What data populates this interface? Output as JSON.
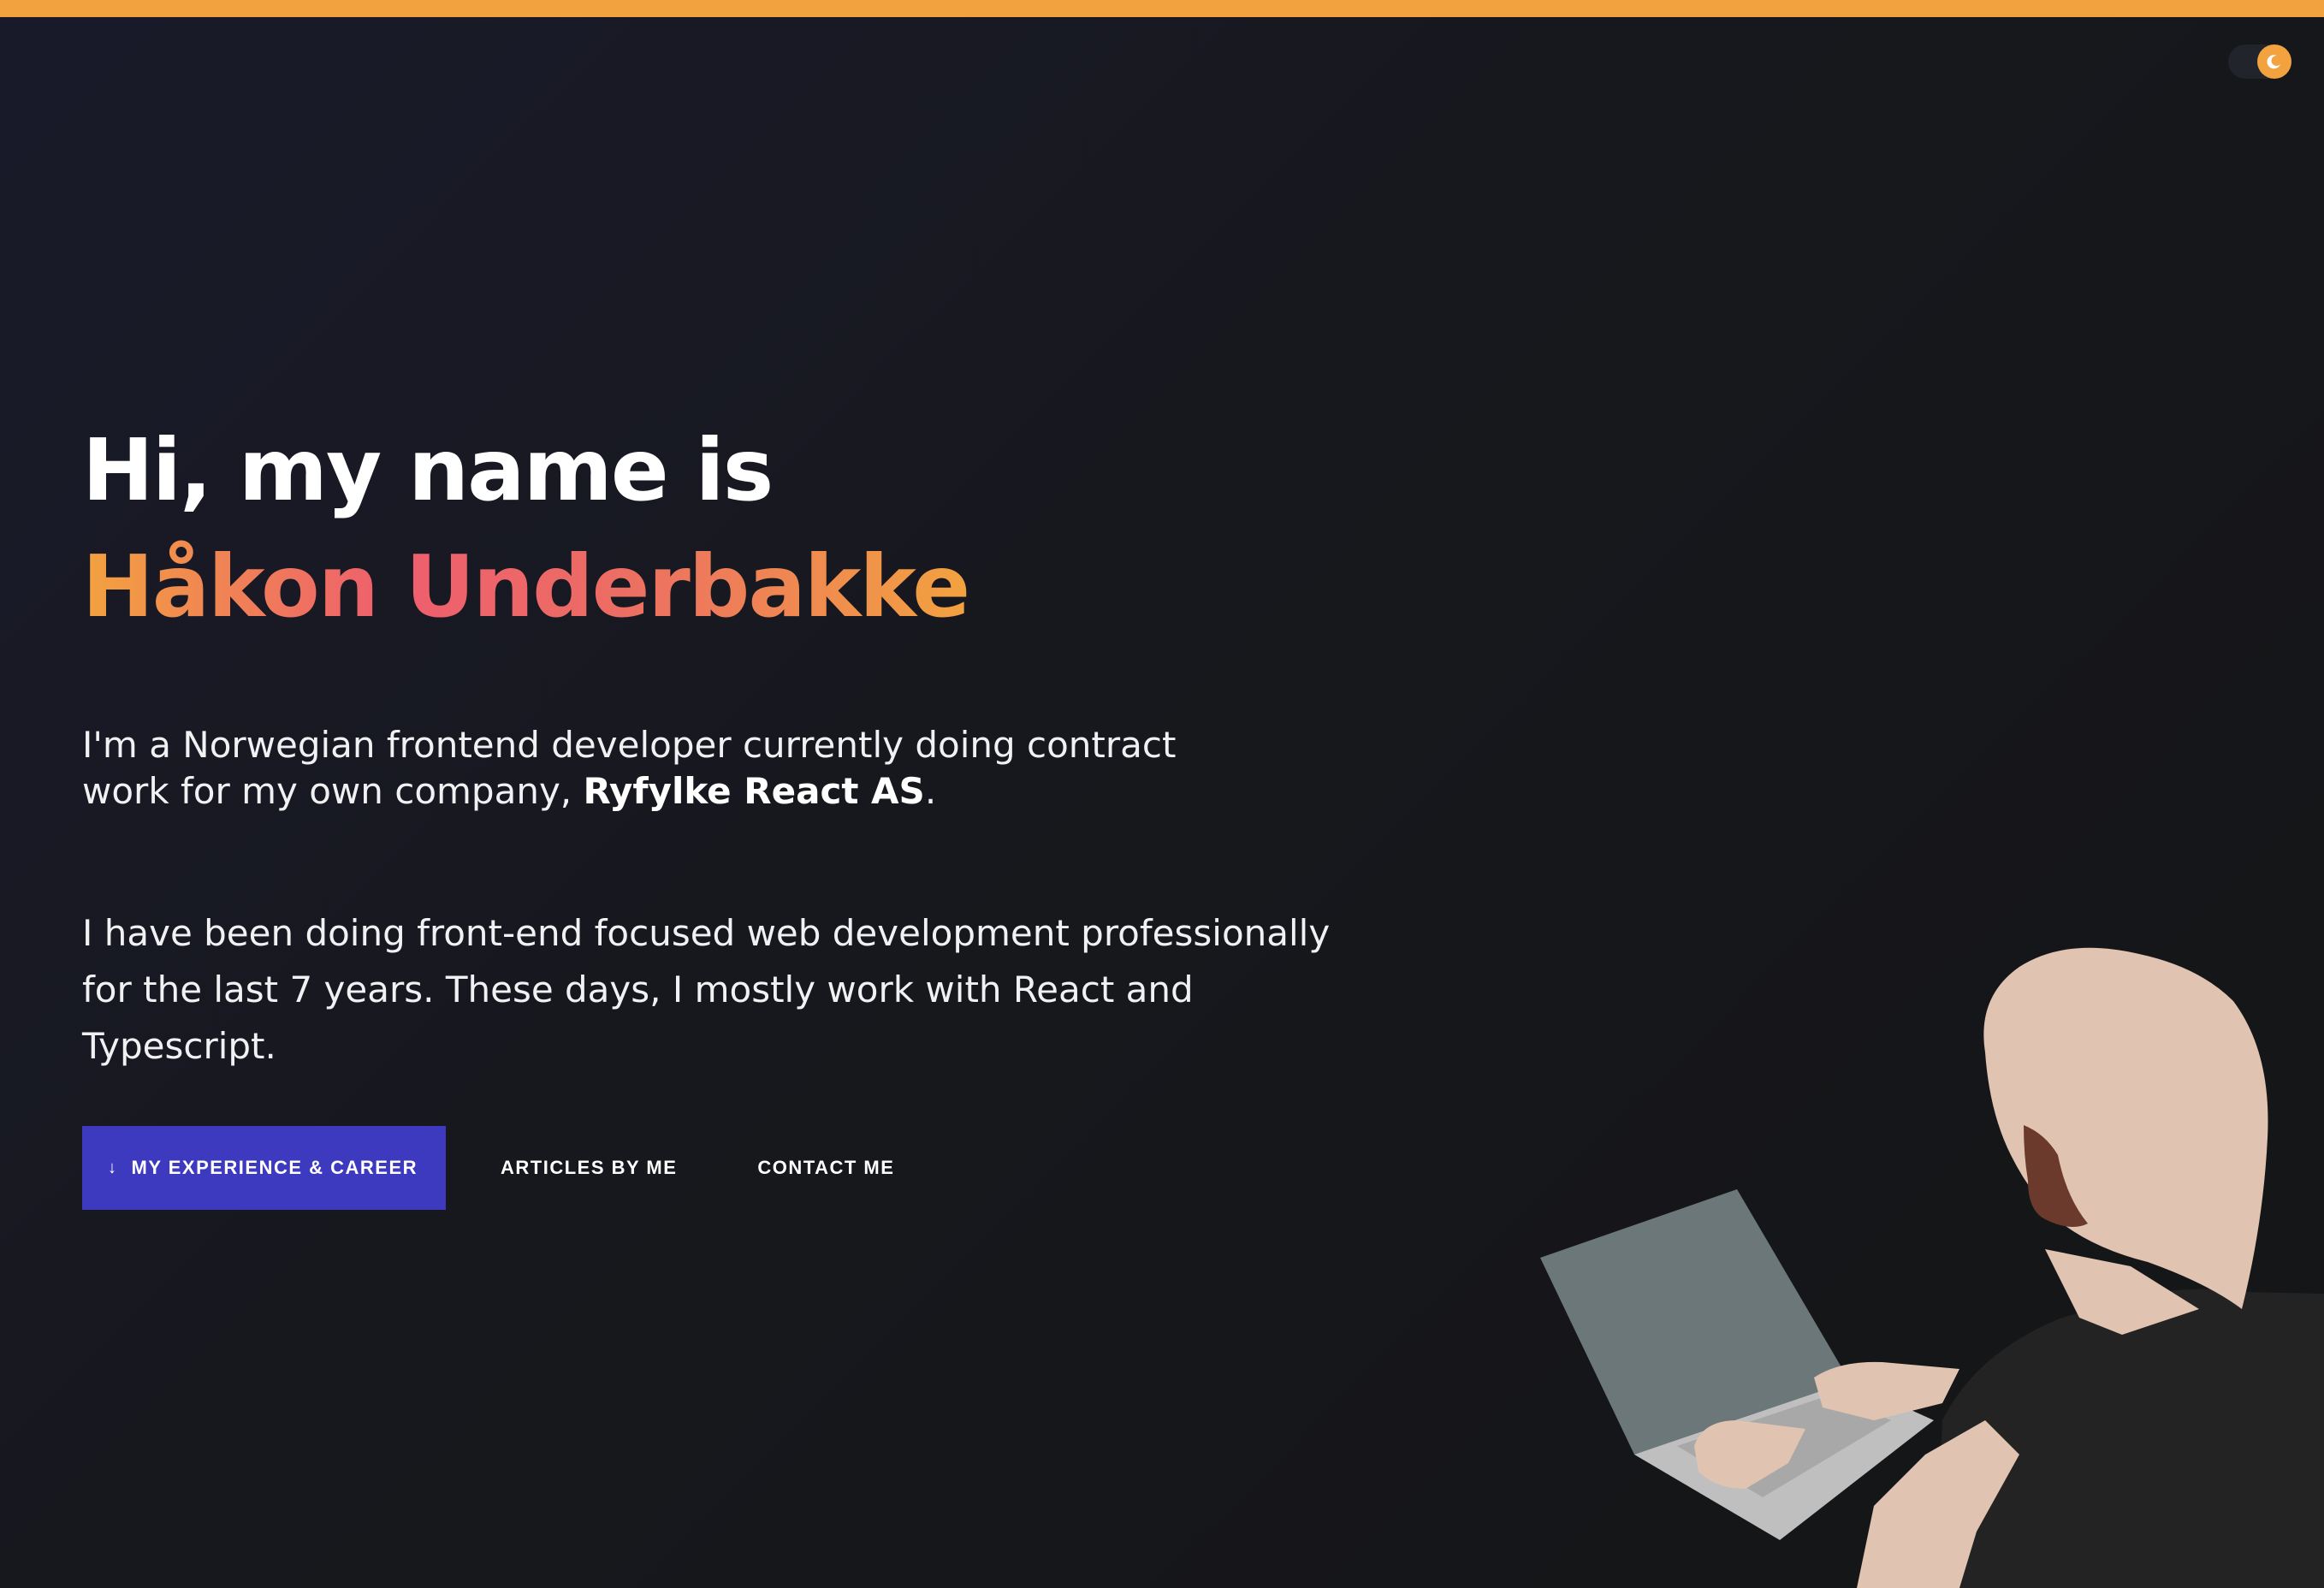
{
  "theme": {
    "accent": "#f2a23f",
    "primary_button": "#3d3ac0",
    "background": "#17181d",
    "toggle_icon": "moon-icon"
  },
  "hero": {
    "greeting": "Hi, my name is",
    "name": "Håkon Underbakke",
    "intro_prefix": "I'm a Norwegian frontend developer currently doing contract work for my own company, ",
    "company": "Ryfylke React AS",
    "intro_suffix": ".",
    "experience": "I have been doing front-end focused web development professionally for the last 7 years. These days, I mostly work with React and Typescript."
  },
  "actions": {
    "experience_icon": "↓",
    "experience_label": "MY EXPERIENCE & CAREER",
    "articles_label": "ARTICLES BY ME",
    "contact_label": "CONTACT ME"
  }
}
